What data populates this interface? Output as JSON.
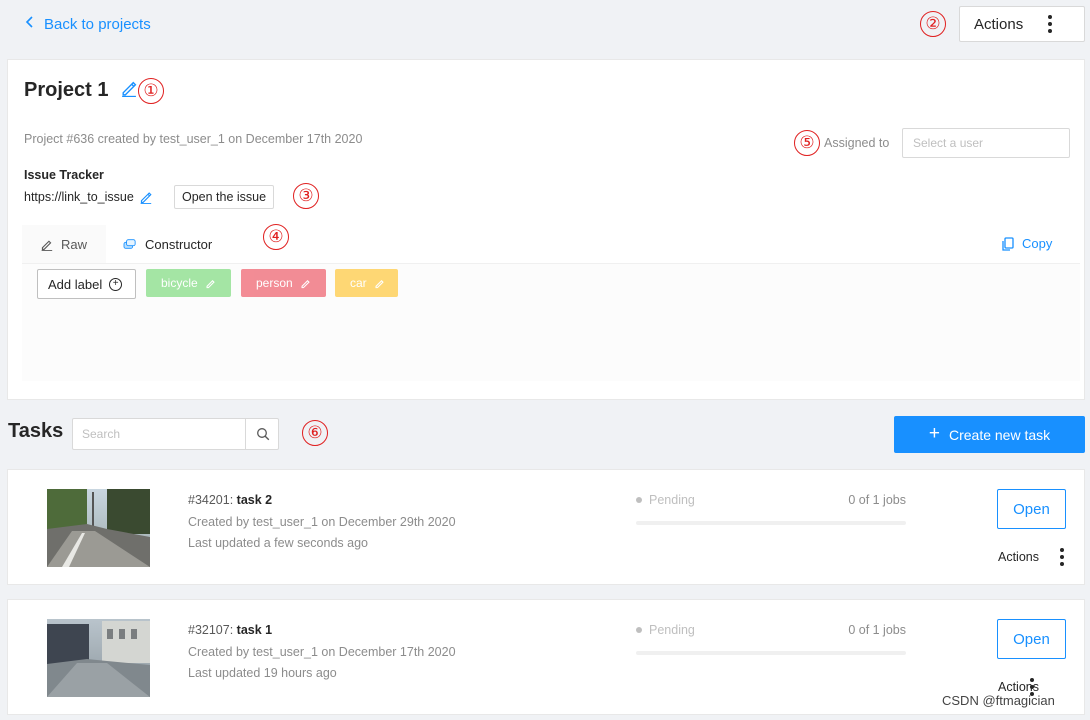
{
  "header": {
    "back_label": "Back to projects",
    "actions_label": "Actions"
  },
  "badges": [
    "①",
    "②",
    "③",
    "④",
    "⑤",
    "⑥"
  ],
  "project": {
    "title": "Project 1",
    "meta": "Project #636 created by test_user_1 on December 17th 2020",
    "assigned_label": "Assigned to",
    "assigned_placeholder": "Select a user",
    "issue_tracker_label": "Issue Tracker",
    "issue_url": "https://link_to_issue",
    "open_issue_label": "Open the issue",
    "tabs": [
      {
        "label": "Raw",
        "icon": "pencil-icon"
      },
      {
        "label": "Constructor",
        "icon": "tags-icon"
      }
    ],
    "copy_label": "Copy",
    "add_label_text": "Add label",
    "labels": [
      {
        "name": "bicycle",
        "color": "#9be39b"
      },
      {
        "name": "person",
        "color": "#f2808a"
      },
      {
        "name": "car",
        "color": "#ffd466"
      }
    ]
  },
  "tasks": {
    "title": "Tasks",
    "search_placeholder": "Search",
    "create_label": "Create new task",
    "items": [
      {
        "id_text": "#34201: ",
        "name": "task 2",
        "created": "Created by test_user_1 on December 29th 2020",
        "updated": "Last updated a few seconds ago",
        "status": "Pending",
        "jobs": "0 of 1 jobs",
        "progress": 0,
        "open_label": "Open",
        "actions_label": "Actions"
      },
      {
        "id_text": "#32107: ",
        "name": "task 1",
        "created": "Created by test_user_1 on December 17th 2020",
        "updated": "Last updated 19 hours ago",
        "status": "Pending",
        "jobs": "0 of 1 jobs",
        "progress": 0,
        "open_label": "Open",
        "actions_label": "Actions"
      }
    ]
  },
  "colors": {
    "accent": "#1890ff",
    "annotation": "#e02020"
  },
  "watermark": "CSDN @ftmagician"
}
